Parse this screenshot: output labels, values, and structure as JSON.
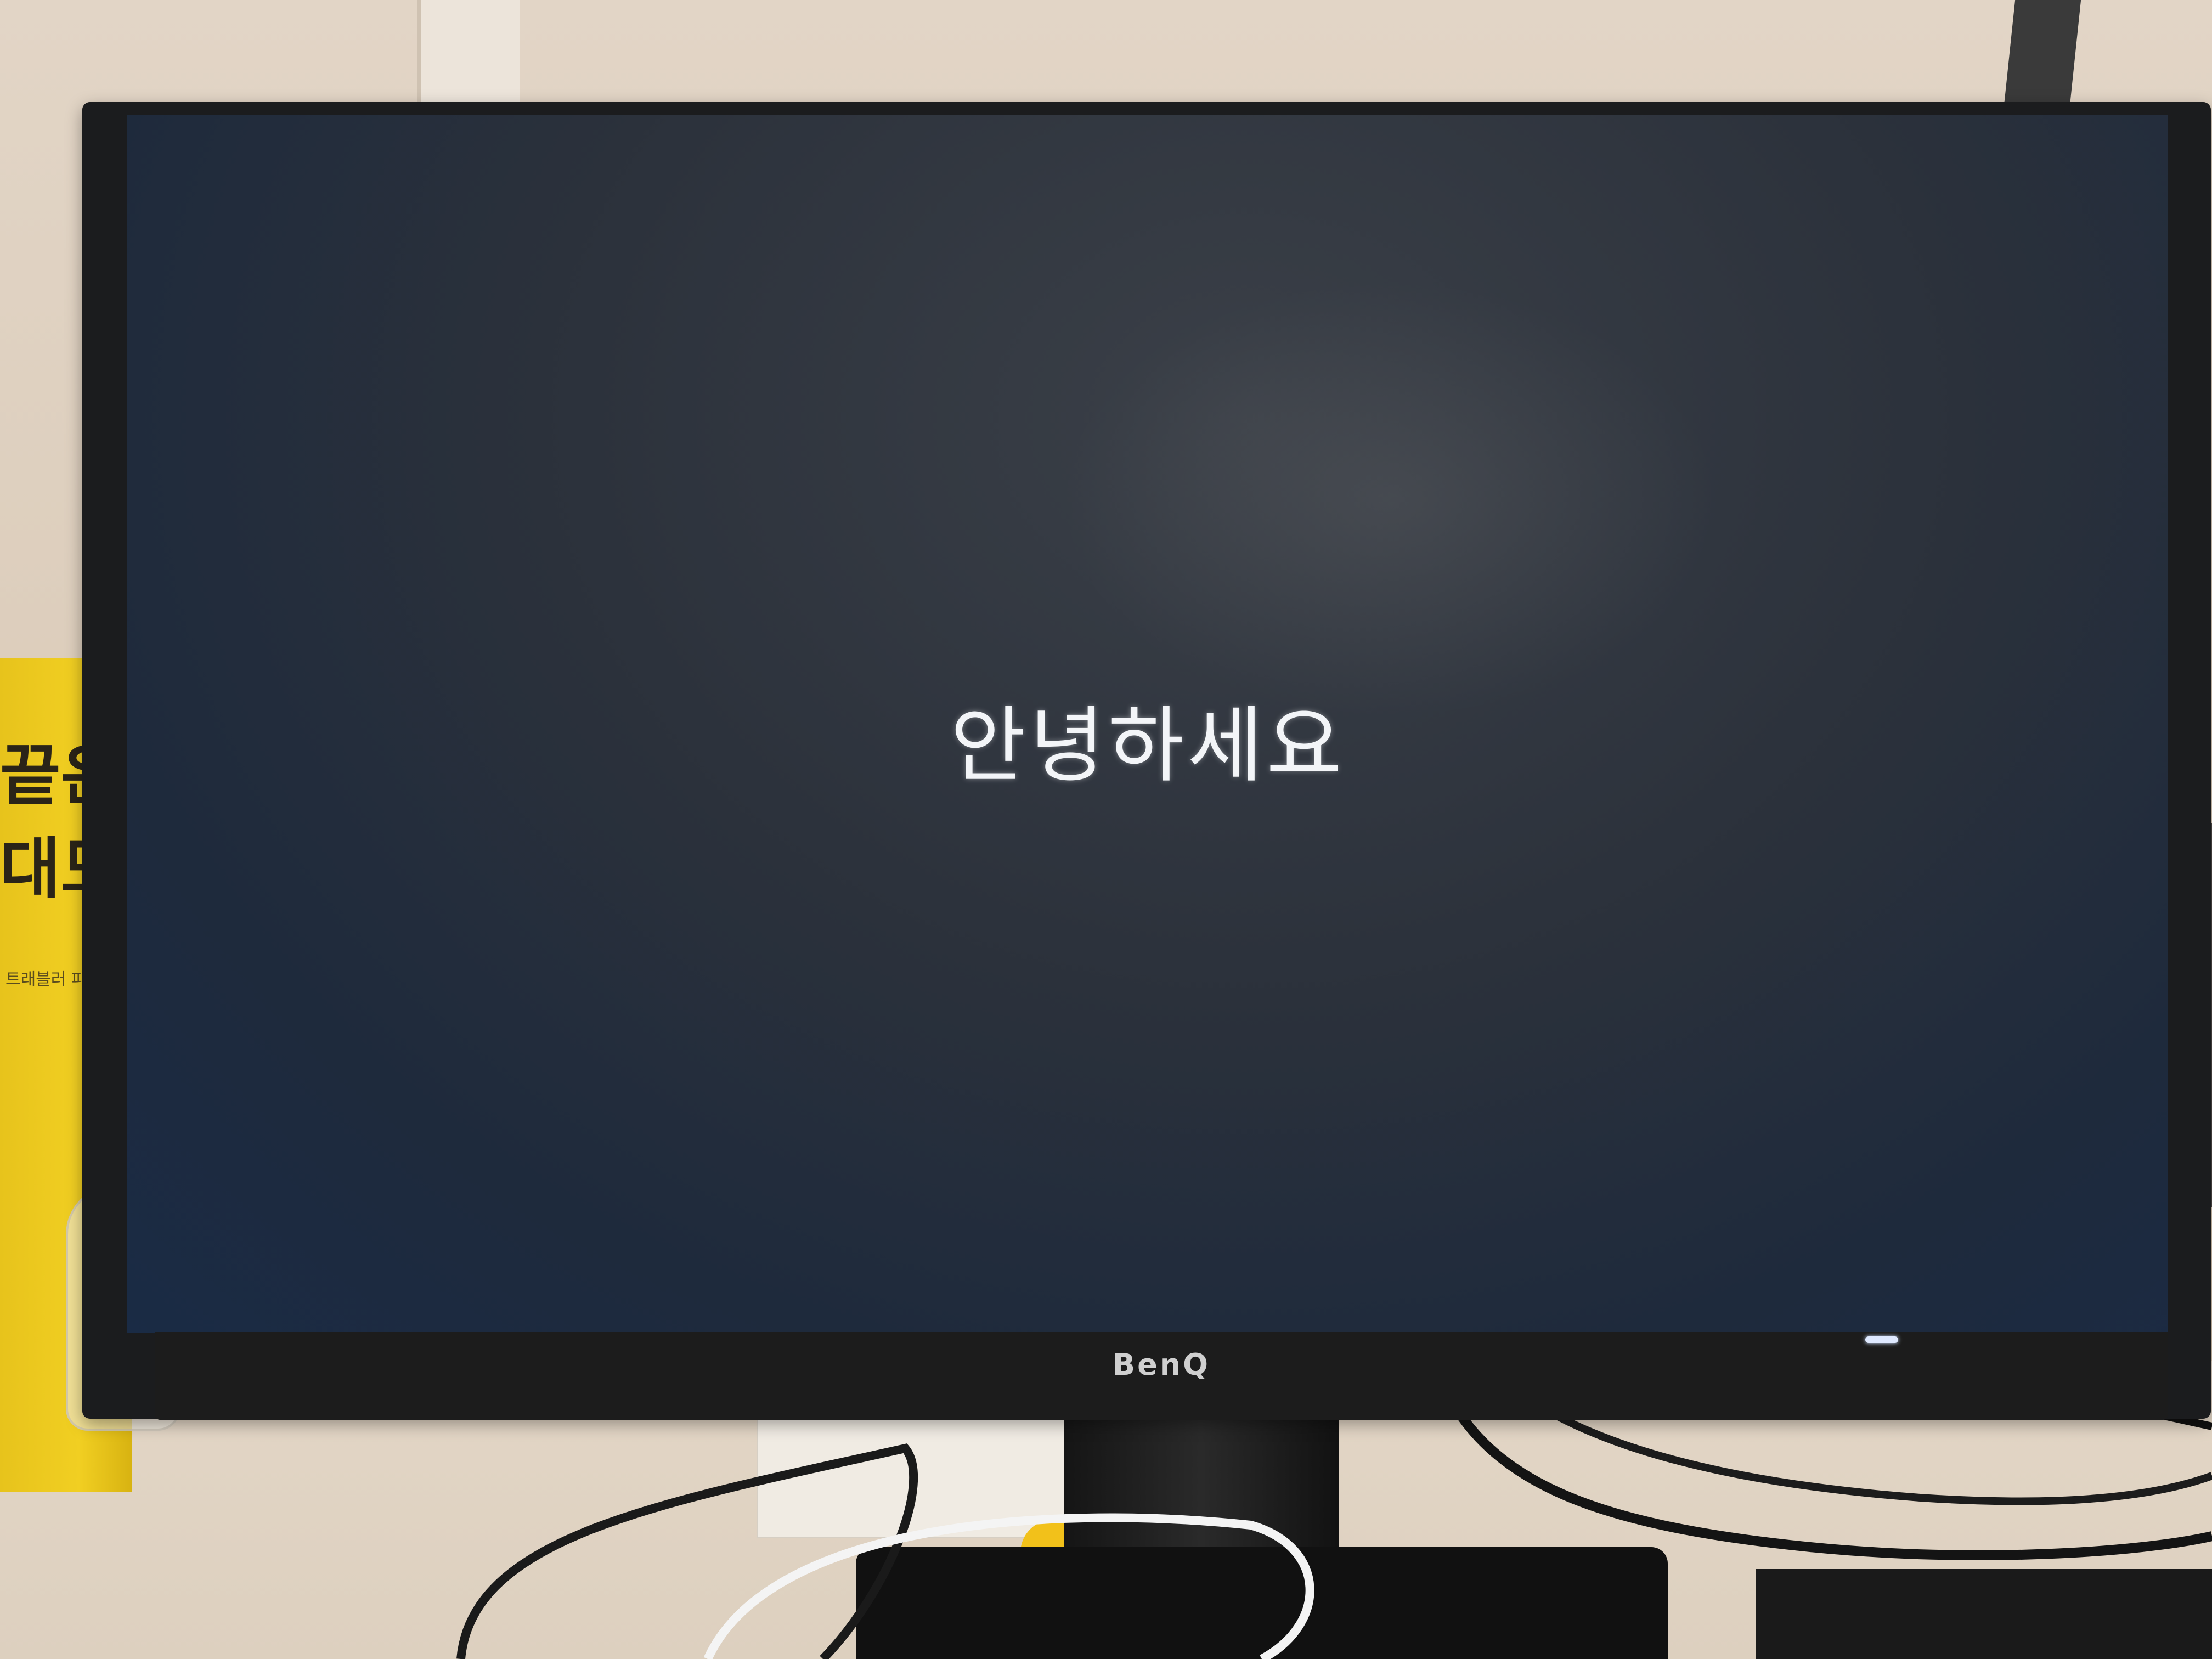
{
  "screen": {
    "greeting": "안녕하세요"
  },
  "monitor": {
    "brand": "BenQ"
  },
  "background": {
    "book_title": "끝은 나\n대도 돼",
    "book_subtitle": "트래블러 파비케"
  },
  "colors": {
    "screen_text": "#f3f5f8",
    "screen_top": "#3b4048",
    "screen_bottom": "#1a2b45",
    "bezel": "#1b1c1e",
    "book": "#f1cf22",
    "wall": "#e2d5c6"
  }
}
